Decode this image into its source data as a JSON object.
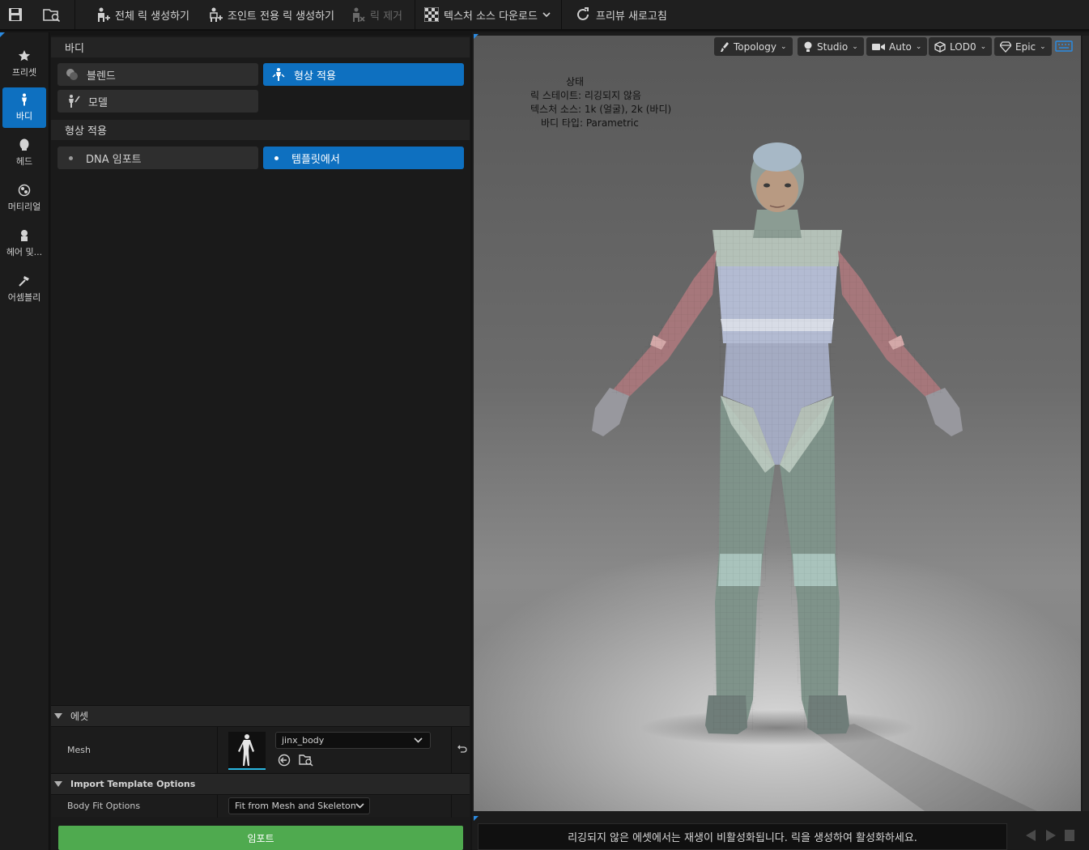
{
  "toolbar": {
    "create_full_rig": "전체 릭 생성하기",
    "create_joints_only_rig": "조인트 전용 릭 생성하기",
    "remove_rig": "릭 제거",
    "download_texture_source": "텍스처 소스 다운로드",
    "refresh_preview": "프리뷰 새로고침"
  },
  "nav": {
    "items": [
      {
        "label": "프리셋",
        "icon": "star-icon"
      },
      {
        "label": "바디",
        "icon": "body-icon",
        "active": true
      },
      {
        "label": "헤드",
        "icon": "head-icon"
      },
      {
        "label": "머티리얼",
        "icon": "material-icon"
      },
      {
        "label": "헤어 및...",
        "icon": "hair-icon"
      },
      {
        "label": "어셈블리",
        "icon": "hammer-icon"
      }
    ]
  },
  "panel": {
    "body_section_title": "바디",
    "body_buttons": {
      "blend": "블렌드",
      "fit_shape": "형상 적용",
      "model": "모델"
    },
    "fit_section_title": "형상 적용",
    "fit_buttons": {
      "dna_import": "DNA 임포트",
      "from_template": "템플릿에서"
    },
    "asset_section_title": "에셋",
    "mesh_label": "Mesh",
    "mesh_value": "jinx_body",
    "import_options_title": "Import Template Options",
    "body_fit_label": "Body Fit Options",
    "body_fit_value": "Fit from Mesh and Skeleton",
    "import_button": "임포트"
  },
  "viewport": {
    "tools": {
      "topology": "Topology",
      "studio": "Studio",
      "auto": "Auto",
      "lod": "LOD0",
      "epic": "Epic"
    },
    "status": {
      "title": "상태",
      "rig_state": "릭 스테이트: 리깅되지 않음",
      "texture_source": "텍스처 소스: 1k (얼굴), 2k (바디)",
      "body_type": "바디 타입: Parametric"
    }
  },
  "message": "리깅되지 않은 에셋에서는 재생이 비활성화됩니다. 릭을 생성하여 활성화하세요.",
  "colors": {
    "accent_blue": "#0e70c0",
    "import_green": "#4faa4f"
  }
}
